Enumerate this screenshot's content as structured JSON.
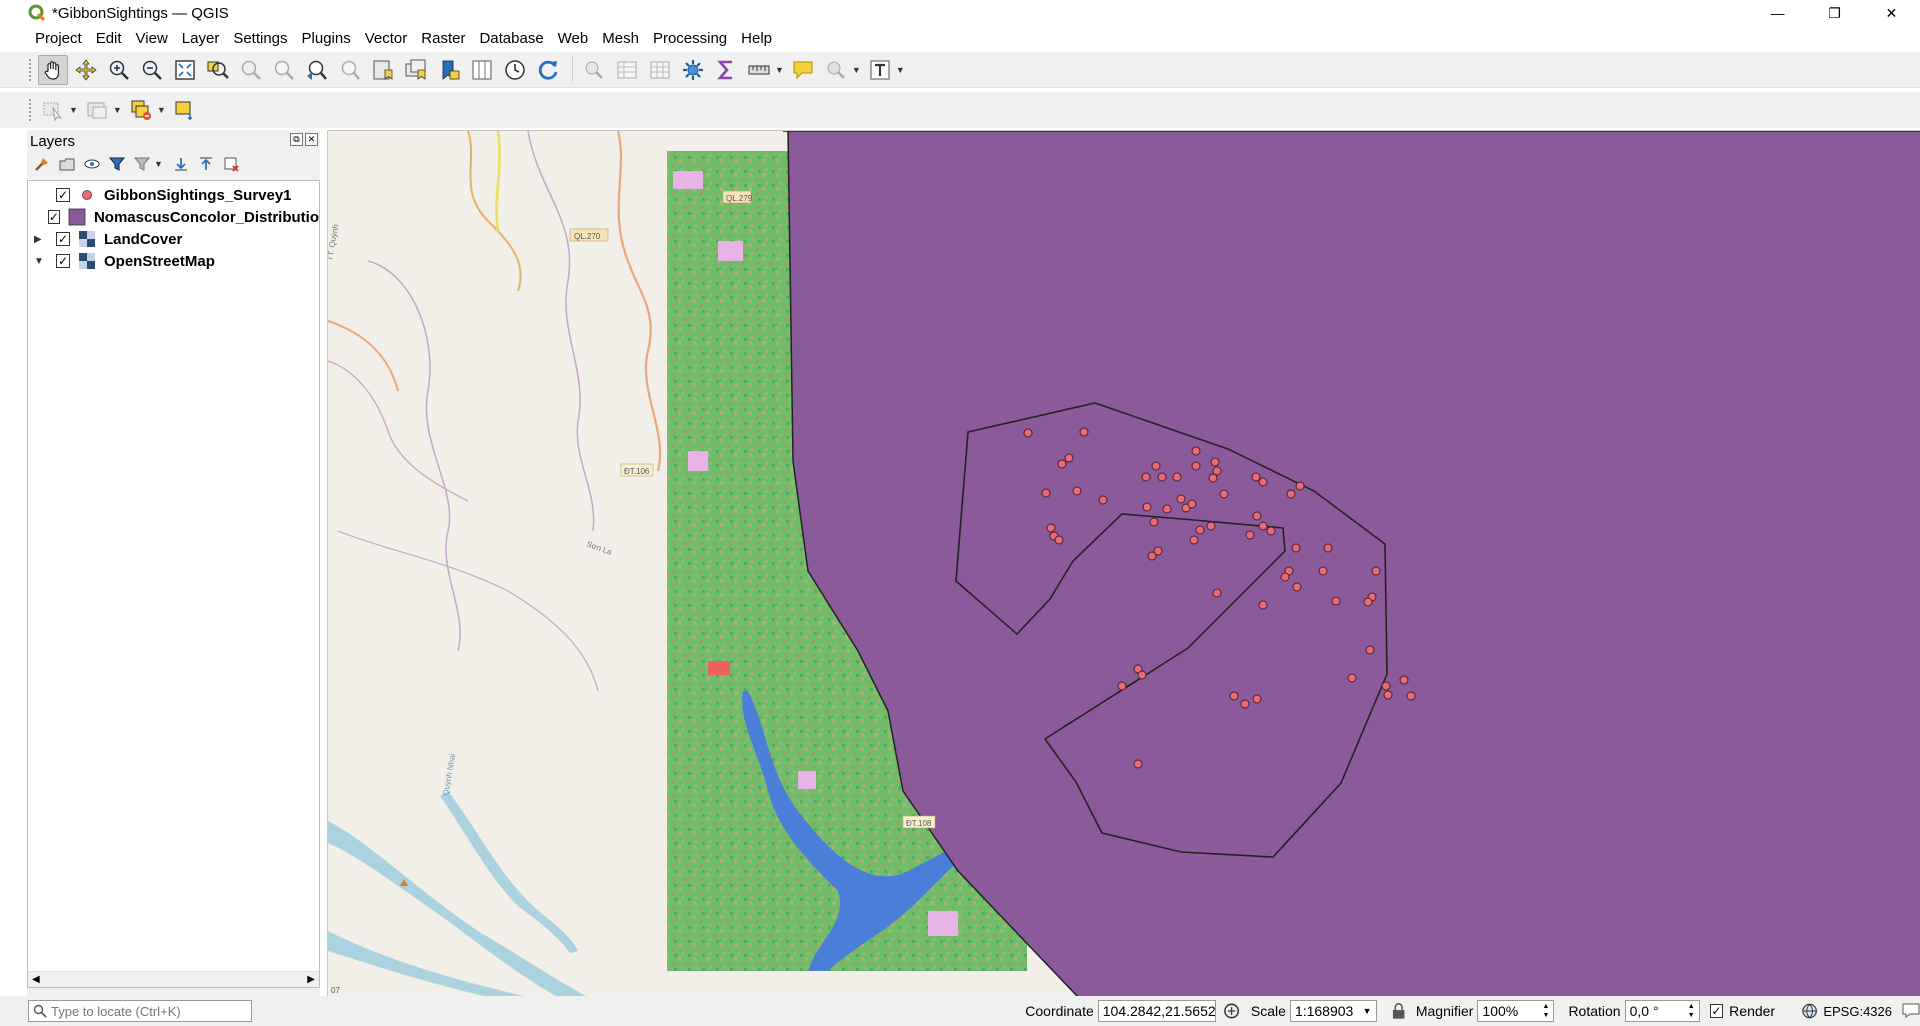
{
  "window": {
    "title": "*GibbonSightings — QGIS",
    "app_icon": "qgis-logo-icon",
    "controls": {
      "minimize": "—",
      "restore": "❐",
      "close": "✕"
    }
  },
  "menubar": {
    "items": [
      "Project",
      "Edit",
      "View",
      "Layer",
      "Settings",
      "Plugins",
      "Vector",
      "Raster",
      "Database",
      "Web",
      "Mesh",
      "Processing",
      "Help"
    ]
  },
  "toolbar1": {
    "tools": [
      "pan-hand-icon",
      "pan-to-selection-icon",
      "zoom-in-icon",
      "zoom-out-icon",
      "zoom-full-icon",
      "zoom-to-selection-icon",
      "zoom-to-layer-icon",
      "zoom-native-icon",
      "zoom-last-icon",
      "zoom-next-icon",
      "new-bookmark-icon",
      "show-bookmarks-icon",
      "new-map-view-icon",
      "temporal-controller-icon",
      "refresh-icon",
      "identify-icon",
      "attribute-table-icon",
      "field-calculator-icon",
      "processing-toolbox-icon",
      "statistics-sigma-icon",
      "measure-icon",
      "map-tips-icon",
      "zoom-to-native-icon",
      "text-annotation-icon"
    ]
  },
  "toolbar2": {
    "tools": [
      "select-features-icon",
      "deselect-icon",
      "select-by-value-icon",
      "add-feature-icon"
    ]
  },
  "layers_panel": {
    "title": "Layers",
    "header_buttons": [
      "⧉",
      "✕"
    ],
    "tools": [
      "open-styling-icon",
      "add-group-icon",
      "manage-themes-icon",
      "filter-legend-icon",
      "filter-expression-icon",
      "expand-all-icon",
      "collapse-all-icon",
      "remove-layer-icon"
    ],
    "layers": [
      {
        "name": "GibbonSightings_Survey1",
        "checked": "✓",
        "expander": "",
        "symbol": "point",
        "color": "#e96b78"
      },
      {
        "name": "NomascusConcolor_Distributio",
        "checked": "✓",
        "expander": "",
        "symbol": "polygon",
        "color": "#8b5a9a"
      },
      {
        "name": "LandCover",
        "checked": "✓",
        "expander": "▶",
        "symbol": "raster"
      },
      {
        "name": "OpenStreetMap",
        "checked": "✓",
        "expander": "▼",
        "symbol": "raster"
      }
    ],
    "scroll_left": "◀",
    "scroll_right": "▶"
  },
  "map": {
    "road_labels": [
      "QL.270",
      "QL.279",
      "ĐT.106",
      "ĐT.108",
      "Sơn La",
      "Quỳnh Nhai",
      "TT. Quỳnh",
      "07"
    ],
    "colors": {
      "distribution": "#8b5a9a",
      "sightings": "#e96b78",
      "landcover": "#6cbf6c",
      "water": "#4a7fd9",
      "base": "#f2efe9"
    }
  },
  "statusbar": {
    "locator_placeholder": "Type to locate (Ctrl+K)",
    "coordinate_label": "Coordinate",
    "coordinate_value": "104.2842,21.5652",
    "scale_label": "Scale",
    "scale_value": "1:168903",
    "magnifier_label": "Magnifier",
    "magnifier_value": "100%",
    "rotation_label": "Rotation",
    "rotation_value": "0,0 °",
    "render_label": "Render",
    "render_checked": "✓",
    "crs": "EPSG:4326"
  }
}
